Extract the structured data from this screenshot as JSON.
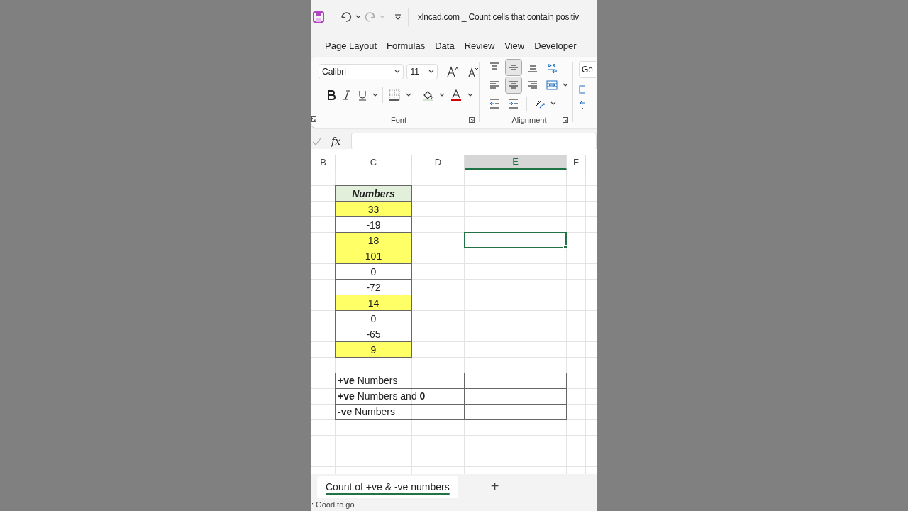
{
  "title_bar": {
    "title": "xlncad.com _ Count cells that contain positiv"
  },
  "ribbon_tabs": [
    {
      "label": "Page Layout",
      "selected": false
    },
    {
      "label": "Formulas",
      "selected": false
    },
    {
      "label": "Data",
      "selected": false
    },
    {
      "label": "Review",
      "selected": false
    },
    {
      "label": "View",
      "selected": false
    },
    {
      "label": "Developer",
      "selected": false
    }
  ],
  "font_group": {
    "font_name": "Calibri",
    "font_size": "11",
    "label": "Font"
  },
  "alignment_group": {
    "label": "Alignment",
    "buttons": [
      {
        "kind": "top",
        "selected": false
      },
      {
        "kind": "middle",
        "selected": true
      },
      {
        "kind": "bottom",
        "selected": false
      },
      {
        "kind": "wrap",
        "selected": false
      },
      {
        "kind": "left",
        "selected": false
      },
      {
        "kind": "center",
        "selected": true
      },
      {
        "kind": "right",
        "selected": false
      },
      {
        "kind": "merge",
        "selected": false
      },
      {
        "kind": "outdent",
        "selected": false
      },
      {
        "kind": "indent",
        "selected": false
      },
      {
        "kind": "orientation",
        "selected": false
      }
    ]
  },
  "number_group": {
    "format": "Ge"
  },
  "formula_bar": {
    "function_label": "fx"
  },
  "columns": [
    {
      "label": "B",
      "selected": false
    },
    {
      "label": "C",
      "selected": false
    },
    {
      "label": "D",
      "selected": false
    },
    {
      "label": "E",
      "selected": true
    },
    {
      "label": "F",
      "selected": false
    }
  ],
  "rows": [
    {
      "kind": "blank",
      "selected": false
    },
    {
      "kind": "header",
      "text": "Numbers",
      "selected": false
    },
    {
      "kind": "value",
      "text": "33",
      "highlighted": true,
      "selected": false
    },
    {
      "kind": "value",
      "text": "-19",
      "highlighted": false,
      "selected": false
    },
    {
      "kind": "value",
      "text": "18",
      "highlighted": true,
      "selected": true
    },
    {
      "kind": "value",
      "text": "101",
      "highlighted": true,
      "selected": false
    },
    {
      "kind": "value",
      "text": "0",
      "highlighted": false,
      "selected": false
    },
    {
      "kind": "value",
      "text": "-72",
      "highlighted": false,
      "selected": false
    },
    {
      "kind": "value",
      "text": "14",
      "highlighted": true,
      "selected": false
    },
    {
      "kind": "value",
      "text": "0",
      "highlighted": false,
      "selected": false
    },
    {
      "kind": "value",
      "text": "-65",
      "highlighted": false,
      "selected": false
    },
    {
      "kind": "value",
      "text": "9",
      "highlighted": true,
      "selected": false
    },
    {
      "kind": "blank",
      "selected": false
    },
    {
      "kind": "summary",
      "label": "**+ve** Numbers",
      "selected": false
    },
    {
      "kind": "summary",
      "label": "**+ve** Numbers and **0**",
      "selected": false
    },
    {
      "kind": "summary",
      "label": "**-ve** Numbers",
      "selected": false
    }
  ],
  "sheet_tabs": [
    {
      "label": "Count of +ve & -ve numbers",
      "selected": true
    }
  ],
  "add_sheet": "+",
  "status_bar": {
    "text": ": Good to go"
  }
}
